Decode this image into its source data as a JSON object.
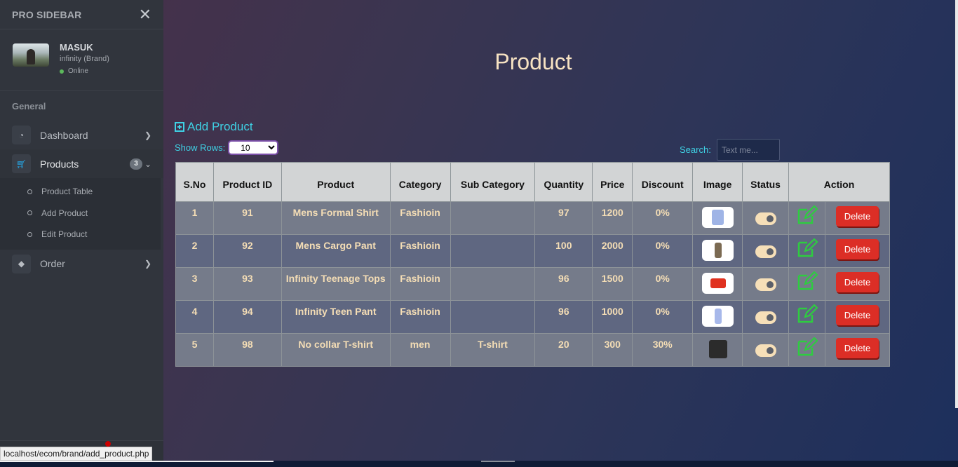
{
  "sidebar": {
    "brand": "PRO SIDEBAR",
    "user": {
      "name": "MASUK",
      "role": "infinity (Brand)",
      "status": "Online"
    },
    "section_header": "General",
    "items": [
      {
        "label": "Dashboard",
        "icon": "tachometer-icon"
      },
      {
        "label": "Products",
        "icon": "shopping-cart-icon",
        "badge": "3",
        "active": true,
        "sub": [
          "Product Table",
          "Add Product",
          "Edit Product"
        ]
      },
      {
        "label": "Order",
        "icon": "gem-icon"
      }
    ]
  },
  "status_url": "localhost/ecom/brand/add_product.php",
  "main": {
    "title": "Product",
    "add_product_label": "Add Product",
    "show_rows_label": "Show Rows:",
    "show_rows_value": "10",
    "search_label": "Search:",
    "search_placeholder": "Text me..."
  },
  "table": {
    "columns": [
      "S.No",
      "Product ID",
      "Product",
      "Category",
      "Sub Category",
      "Quantity",
      "Price",
      "Discount",
      "Image",
      "Status",
      "Action"
    ],
    "delete_label": "Delete",
    "rows": [
      {
        "sno": "1",
        "id": "91",
        "product": "Mens Formal Shirt",
        "category": "Fashioin",
        "sub": "",
        "qty": "97",
        "price": "1200",
        "discount": "0%",
        "image": "shirt-thumbnail"
      },
      {
        "sno": "2",
        "id": "92",
        "product": "Mens Cargo Pant",
        "category": "Fashioin",
        "sub": "",
        "qty": "100",
        "price": "2000",
        "discount": "0%",
        "image": "pant-thumbnail"
      },
      {
        "sno": "3",
        "id": "93",
        "product": "Infinity Teenage Tops",
        "category": "Fashioin",
        "sub": "",
        "qty": "96",
        "price": "1500",
        "discount": "0%",
        "image": "top-thumbnail"
      },
      {
        "sno": "4",
        "id": "94",
        "product": "Infinity Teen Pant",
        "category": "Fashioin",
        "sub": "",
        "qty": "96",
        "price": "1000",
        "discount": "0%",
        "image": "teen-pant-thumbnail"
      },
      {
        "sno": "5",
        "id": "98",
        "product": "No collar T-shirt",
        "category": "men",
        "sub": "T-shirt",
        "qty": "20",
        "price": "300",
        "discount": "30%",
        "image": "tshirt-thumbnail"
      }
    ]
  },
  "colors": {
    "accent": "#3fd1e4",
    "title": "#f6e2c2",
    "delete": "#dc2e26",
    "edit": "#2ecc40"
  }
}
